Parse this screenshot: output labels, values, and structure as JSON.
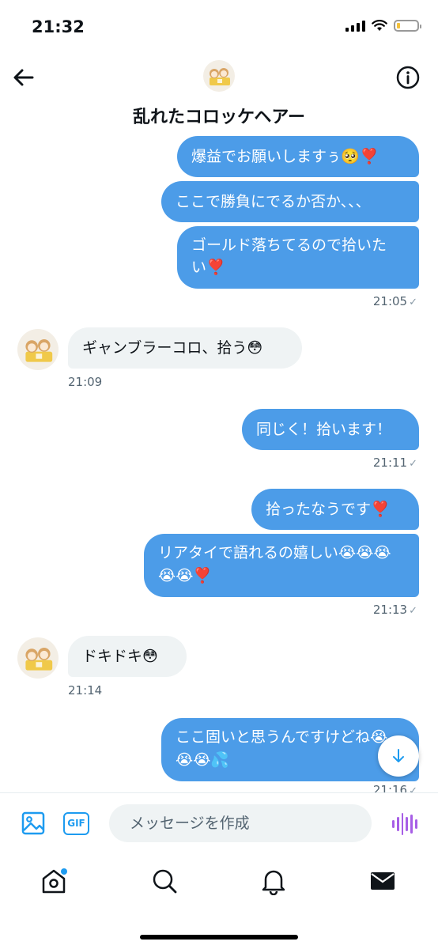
{
  "status_bar": {
    "time": "21:32"
  },
  "header": {
    "title": "乱れたコロッケヘアー"
  },
  "messages": [
    {
      "text": "爆益でお願いしますぅ🥺❣️"
    },
    {
      "text": "ここで勝負にでるか否か、、、"
    },
    {
      "text": "ゴールド落ちてるので拾いたい❣️",
      "time": "21:05"
    },
    {
      "text": "ギャンブラーコロ、拾う😳",
      "time": "21:09"
    },
    {
      "text": "同じく！拾います！",
      "time": "21:11"
    },
    {
      "text": "拾ったなうです❣️"
    },
    {
      "text": "リアタイで語れるの嬉しい😭😭😭😭😭❣️",
      "time": "21:13"
    },
    {
      "text": "ドキドキ😳",
      "time": "21:14"
    },
    {
      "text": "ここ固いと思うんですけどね😭😭😭💦",
      "time": "21:16"
    }
  ],
  "composer": {
    "placeholder": "メッセージを作成",
    "gif_label": "GIF"
  },
  "colors": {
    "accent": "#1d9bf0",
    "bubble_out": "#4c9ce8",
    "bubble_in": "#eff3f4",
    "voice": "#a75ee6"
  }
}
